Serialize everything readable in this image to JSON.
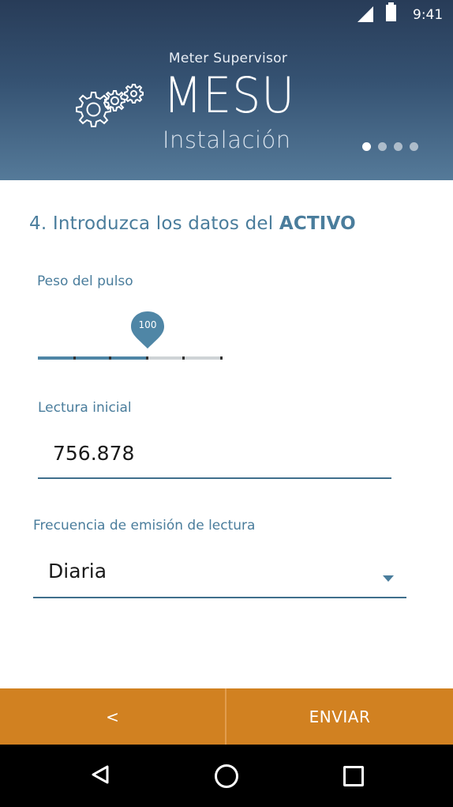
{
  "status": {
    "time": "9:41"
  },
  "header": {
    "subtitle": "Meter Supervisor",
    "title": "MESU",
    "section": "Instalación",
    "page_indicator": {
      "total": 4,
      "current": 1
    }
  },
  "form": {
    "step_prefix": "4. Introduzca los datos del ",
    "step_emphasis": "ACTIVO",
    "pulse_weight": {
      "label": "Peso del pulso",
      "value": "100",
      "fill_fraction": 0.6
    },
    "initial_reading": {
      "label": "Lectura inicial",
      "value": "756.878"
    },
    "frequency": {
      "label": "Frecuencia de emisión de lectura",
      "selected": "Diaria"
    }
  },
  "actions": {
    "back_label": "<",
    "send_label": "ENVIAR"
  },
  "colors": {
    "accent": "#4a7d9c",
    "action_bar": "#d18121",
    "header_top": "#283c58",
    "header_bottom": "#557a99"
  },
  "icons": {
    "gears": "gears-icon",
    "nav_back": "nav-back-icon",
    "nav_home": "nav-home-icon",
    "nav_recents": "nav-recents-icon"
  }
}
